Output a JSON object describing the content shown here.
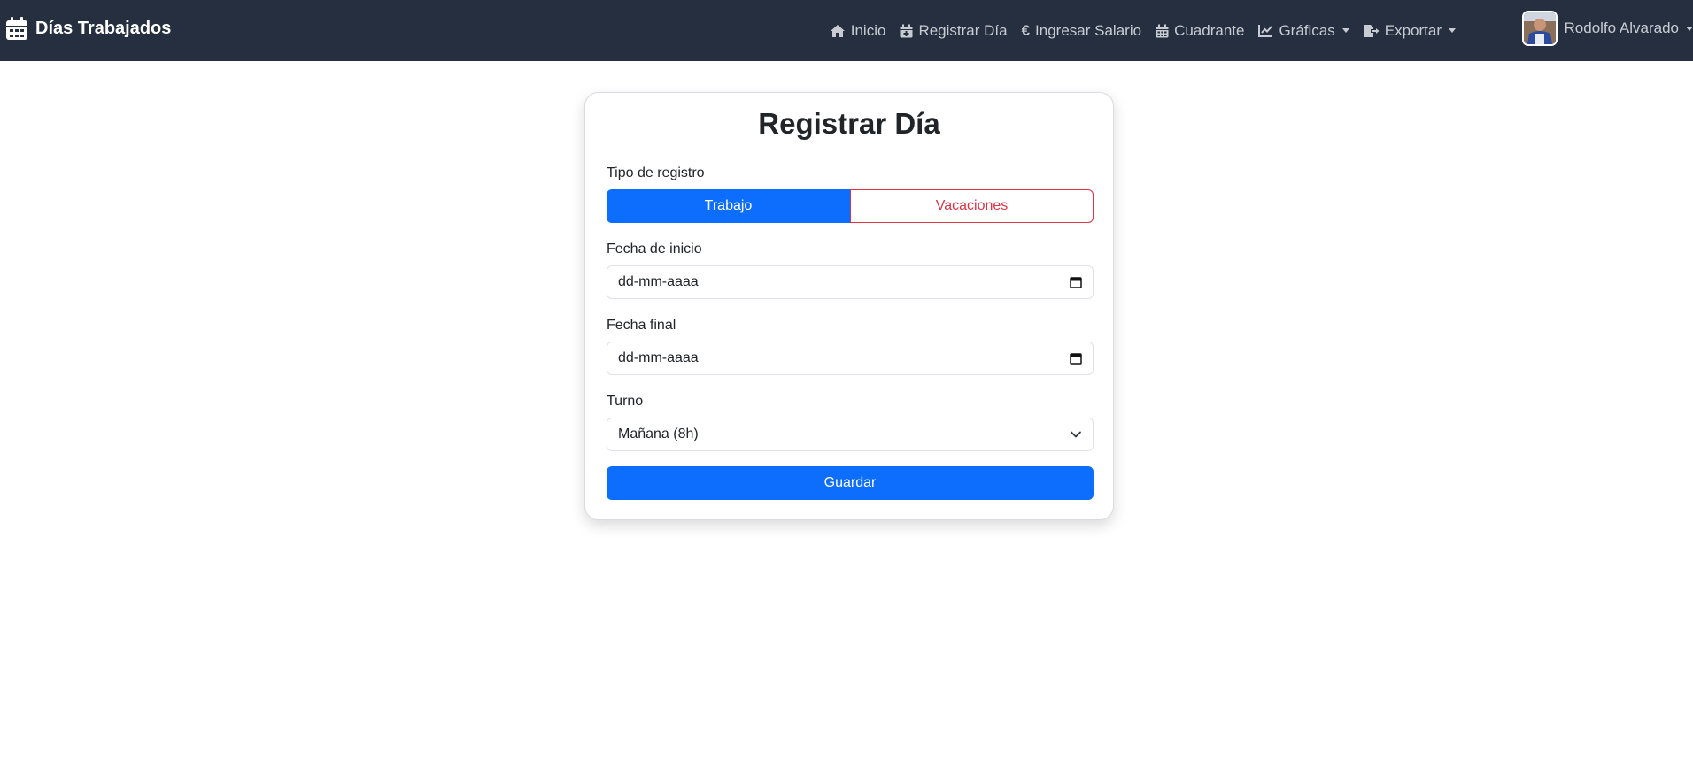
{
  "navbar": {
    "brand": "Días Trabajados",
    "brand_icon": "calendar-icon",
    "links": [
      {
        "label": "Inicio",
        "icon": "home-icon"
      },
      {
        "label": "Registrar Día",
        "icon": "calendar-plus-icon"
      },
      {
        "label": "Ingresar Salario",
        "icon": "euro-icon"
      },
      {
        "label": "Cuadrante",
        "icon": "calendar-grid-icon"
      },
      {
        "label": "Gráficas",
        "icon": "chart-line-icon",
        "dropdown": true
      },
      {
        "label": "Exportar",
        "icon": "export-icon",
        "dropdown": true
      }
    ],
    "user": {
      "name": "Rodolfo Alvarado",
      "dropdown": true
    }
  },
  "form": {
    "title": "Registrar Día",
    "tipo_label": "Tipo de registro",
    "tipo_options": [
      {
        "label": "Trabajo",
        "active": true
      },
      {
        "label": "Vacaciones",
        "active": false
      }
    ],
    "fecha_inicio_label": "Fecha de inicio",
    "fecha_inicio_value": "dd-mm-aaaa",
    "fecha_final_label": "Fecha final",
    "fecha_final_value": "dd-mm-aaaa",
    "turno_label": "Turno",
    "turno_value": "Mañana (8h)",
    "save_label": "Guardar"
  },
  "colors": {
    "navbar_bg": "#252f3f",
    "primary": "#0d6efd",
    "danger": "#dc3545"
  }
}
